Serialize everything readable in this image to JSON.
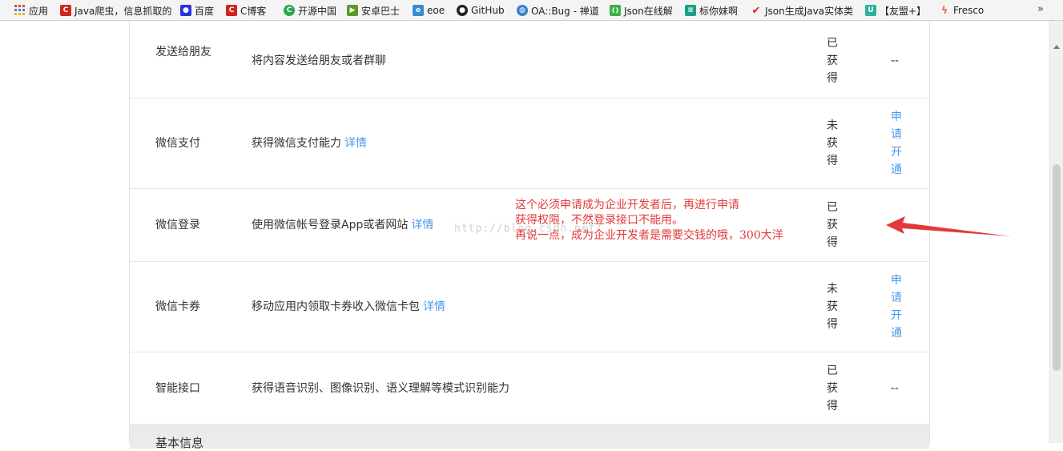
{
  "bookmarks": {
    "items": [
      {
        "label": "应用",
        "icon": "apps-grid-icon",
        "color": "#e04a3a"
      },
      {
        "label": "Java爬虫，信息抓取的",
        "icon": "csdn-icon",
        "color": "#d0261b"
      },
      {
        "label": "百度",
        "icon": "baidu-paw-icon",
        "color": "#2932e1"
      },
      {
        "label": "C博客",
        "icon": "csdn-icon",
        "color": "#d0261b"
      },
      {
        "label": "开源中国",
        "icon": "oschina-icon",
        "color": "#2aa84a"
      },
      {
        "label": "安卓巴士",
        "icon": "android-bus-icon",
        "color": "#5a9a2a"
      },
      {
        "label": "eoe",
        "icon": "eoe-icon",
        "color": "#3a8ad6"
      },
      {
        "label": "GitHub",
        "icon": "github-icon",
        "color": "#222222"
      },
      {
        "label": "OA::Bug - 禅道",
        "icon": "globe-icon",
        "color": "#3c7fc8"
      },
      {
        "label": "Json在线解",
        "icon": "json-icon",
        "color": "#3cb04a"
      },
      {
        "label": "标你妹啊",
        "icon": "tag-icon",
        "color": "#1aa08a"
      },
      {
        "label": "Json生成Java实体类",
        "icon": "check-icon",
        "color": "#e02020"
      },
      {
        "label": "【友盟+】",
        "icon": "umeng-icon",
        "color": "#2bb39a"
      },
      {
        "label": "Fresco",
        "icon": "fresco-icon",
        "color": "#e8734a"
      }
    ],
    "more": "»"
  },
  "rows": [
    {
      "name": "发送给朋友",
      "desc": "将内容发送给朋友或者群聊",
      "link": "",
      "status": "已获得",
      "op": "--"
    },
    {
      "name": "微信支付",
      "desc": "获得微信支付能力",
      "link": "详情",
      "status": "未获得",
      "op": "申请开通"
    },
    {
      "name": "微信登录",
      "desc": "使用微信帐号登录App或者网站",
      "link": "详情",
      "status": "已获得",
      "op": ""
    },
    {
      "name": "微信卡券",
      "desc": "移动应用内领取卡券收入微信卡包",
      "link": "详情",
      "status": "未获得",
      "op": "申请开通"
    },
    {
      "name": "智能接口",
      "desc": "获得语音识别、图像识别、语义理解等模式识别能力",
      "link": "",
      "status": "已获得",
      "op": "--"
    }
  ],
  "section": {
    "title": "基本信息"
  },
  "annotation": {
    "line1": "这个必须申请成为企业开发者后，再进行申请",
    "line2": "获得权限，不然登录接口不能用。",
    "line3": "再说一点，成为企业开发者是需要交钱的哦，300大洋",
    "color": "#e23a3a"
  },
  "watermark": "http://blog.csdn.net/"
}
